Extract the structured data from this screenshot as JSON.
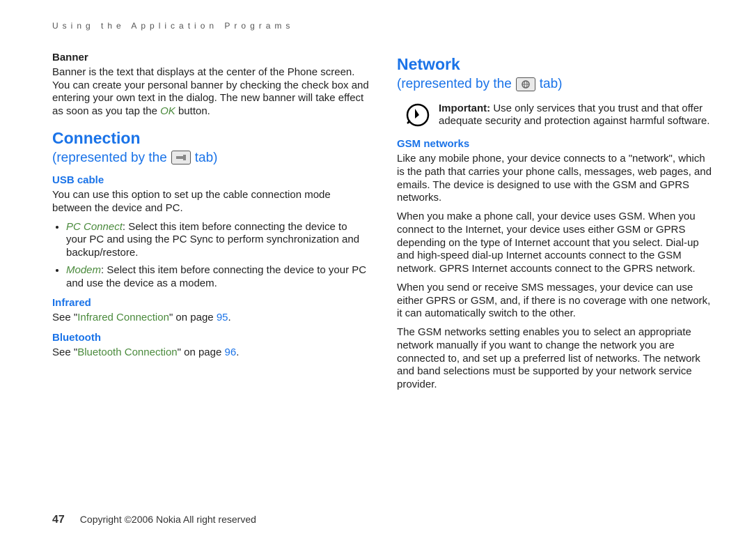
{
  "header": "Using the Application Programs",
  "left": {
    "bannerTitle": "Banner",
    "bannerText1": "Banner is the text that displays at the center of the Phone screen. You can create your personal banner by checking the check box and entering your own text in the dialog. The new banner will take effect as soon as you tap the ",
    "bannerOk": "OK",
    "bannerText2": " button.",
    "connectionTitle": "Connection",
    "subPrefix": "(represented by the ",
    "subSuffix": " tab)",
    "usbTitle": "USB cable",
    "usbText": "You can use this option to set up the cable connection mode between the device and PC.",
    "li1a": "PC Connect",
    "li1b": ": Select this item before connecting the device to your PC and using the PC Sync to perform synchronization and backup/restore.",
    "li2a": "Modem",
    "li2b": ": Select this item before connecting the device to your PC and use the device as a modem.",
    "infraredTitle": "Infrared",
    "infraredSee": "See \"",
    "infraredLink": "Infrared Connection",
    "infraredAfter": "\" on page ",
    "infraredPage": "95",
    "infraredEnd": ".",
    "btTitle": "Bluetooth",
    "btSee": "See \"",
    "btLink": "Bluetooth Connection",
    "btAfter": "\" on page ",
    "btPage": "96",
    "btEnd": "."
  },
  "right": {
    "networkTitle": "Network",
    "subPrefix": "(represented by the ",
    "subSuffix": " tab)",
    "importantBold": "Important:",
    "importantText": " Use only services that you trust and that offer adequate security and protection against harmful software.",
    "gsmTitle": "GSM networks",
    "p1": "Like any mobile phone, your device connects to a \"network\", which is the path that carries your phone calls, messages, web pages, and emails. The device is designed to use with the GSM and GPRS networks.",
    "p2": "When you make a phone call, your device uses GSM. When you connect to the Internet, your device uses either GSM or GPRS depending on the type of Internet account that you select. Dial-up and high-speed dial-up Internet accounts connect to the GSM network. GPRS Internet accounts connect to the GPRS network.",
    "p3": "When you send or receive SMS messages, your device can use either GPRS or GSM, and, if there is no coverage with one network, it can automatically switch to the other.",
    "p4": "The GSM networks setting enables you to select an appropriate network manually if you want to change the network you are connected to, and set up a preferred list of networks. The network and band selections must be supported by your network service provider."
  },
  "footer": {
    "pageNum": "47",
    "copyright": "Copyright ©2006 Nokia All right reserved"
  }
}
